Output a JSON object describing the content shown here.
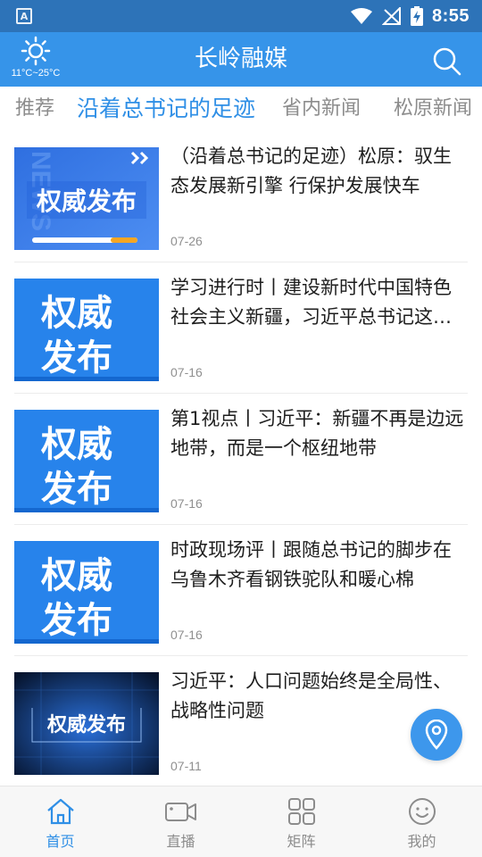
{
  "status_bar": {
    "notification_icon": "A",
    "time": "8:55"
  },
  "header": {
    "title": "长岭融媒",
    "weather_temp": "11°C~25°C",
    "weather_icon": "sun-icon",
    "search_icon": "search-icon"
  },
  "tabs": [
    {
      "label": "推荐",
      "active": false
    },
    {
      "label": "沿着总书记的足迹",
      "active": true
    },
    {
      "label": "省内新闻",
      "active": false
    },
    {
      "label": "松原新闻",
      "active": false
    }
  ],
  "news": [
    {
      "title": "（沿着总书记的足迹）松原：驭生态发展新引擎 行保护发展快车",
      "date": "07-26",
      "thumb_text": "权威发布",
      "thumb_watermark": "NEWS"
    },
    {
      "title": "学习进行时丨建设新时代中国特色社会主义新疆，习近平总书记这样部署",
      "date": "07-16",
      "thumb_text_1": "权威",
      "thumb_text_2": "发布"
    },
    {
      "title": "第1视点丨习近平：新疆不再是边远地带，而是一个枢纽地带",
      "date": "07-16",
      "thumb_text_1": "权威",
      "thumb_text_2": "发布"
    },
    {
      "title": "时政现场评丨跟随总书记的脚步在乌鲁木齐看钢铁驼队和暖心棉",
      "date": "07-16",
      "thumb_text_1": "权威",
      "thumb_text_2": "发布"
    },
    {
      "title": "习近平：人口问题始终是全局性、战略性问题",
      "date": "07-11",
      "thumb_text": "权威发布"
    }
  ],
  "bottom_nav": [
    {
      "label": "首页",
      "icon": "home-icon",
      "active": true
    },
    {
      "label": "直播",
      "icon": "video-camera-icon",
      "active": false
    },
    {
      "label": "矩阵",
      "icon": "grid-icon",
      "active": false
    },
    {
      "label": "我的",
      "icon": "smiley-face-icon",
      "active": false
    }
  ],
  "colors": {
    "status_bar": "#2d73b8",
    "header": "#3694e9",
    "accent": "#2f8fe6",
    "fab": "#3d97ec"
  }
}
